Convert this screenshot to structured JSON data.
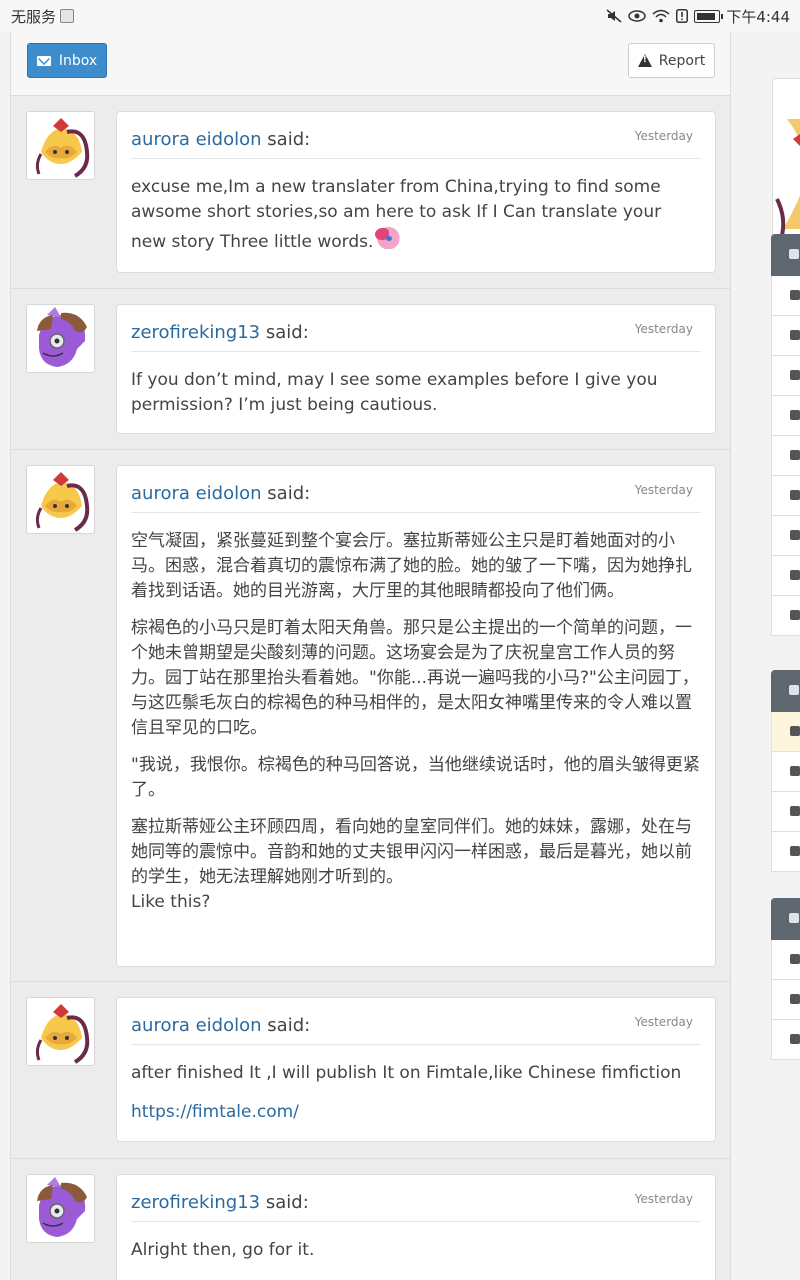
{
  "status_bar": {
    "carrier": "无服务",
    "time": "下午4:44",
    "icons": [
      "sim-icon",
      "mute-icon",
      "eye-icon",
      "wifi-icon",
      "alert-icon",
      "battery-icon"
    ],
    "battery_level": 0.85
  },
  "toolbar": {
    "inbox_label": "Inbox",
    "report_label": "Report"
  },
  "messages": [
    {
      "author": "aurora eidolon",
      "said": "said:",
      "time": "Yesterday",
      "paragraphs": [
        "excuse me,Im a new translater from China,trying to find some awsome short stories,so am here to ask If I Can translate your new story Three little words."
      ]
    },
    {
      "author": "zerofireking13",
      "said": "said:",
      "time": "Yesterday",
      "paragraphs": [
        "If you don’t mind, may I see some examples before I give you permission? I’m just being cautious."
      ]
    },
    {
      "author": "aurora eidolon",
      "said": "said:",
      "time": "Yesterday",
      "paragraphs": [
        "空气凝固，紧张蔓延到整个宴会厅。塞拉斯蒂娅公主只是盯着她面对的小马。困惑，混合着真切的震惊布满了她的脸。她的皱了一下嘴，因为她挣扎着找到话语。她的目光游离，大厅里的其他眼睛都投向了他们俩。",
        "棕褐色的小马只是盯着太阳天角兽。那只是公主提出的一个简单的问题，一个她未曾期望是尖酸刻薄的问题。这场宴会是为了庆祝皇宫工作人员的努力。园丁站在那里抬头看着她。\"你能...再说一遍吗我的小马?\"公主问园丁，与这匹鬃毛灰白的棕褐色的种马相伴的，是太阳女神嘴里传来的令人难以置信且罕见的口吃。",
        "\"我说，我恨你。棕褐色的种马回答说，当他继续说话时，他的眉头皱得更紧了。",
        "塞拉斯蒂娅公主环顾四周，看向她的皇室同伴们。她的妹妹，露娜，处在与她同等的震惊中。音韵和她的丈夫银甲闪闪一样困惑，最后是暮光，她以前的学生，她无法理解她刚才听到的。",
        "Like this?"
      ]
    },
    {
      "author": "aurora eidolon",
      "said": "said:",
      "time": "Yesterday",
      "paragraphs": [
        "after finished It ,I will publish It on Fimtale,like Chinese fimfiction"
      ],
      "link": "https://fimtale.com/"
    },
    {
      "author": "zerofireking13",
      "said": "said:",
      "time": "Yesterday",
      "paragraphs": [
        "Alright then, go for it."
      ]
    }
  ],
  "colors": {
    "accent": "#3d8ccc",
    "link": "#2a6a9f",
    "sidebar_header": "#5e6670"
  }
}
